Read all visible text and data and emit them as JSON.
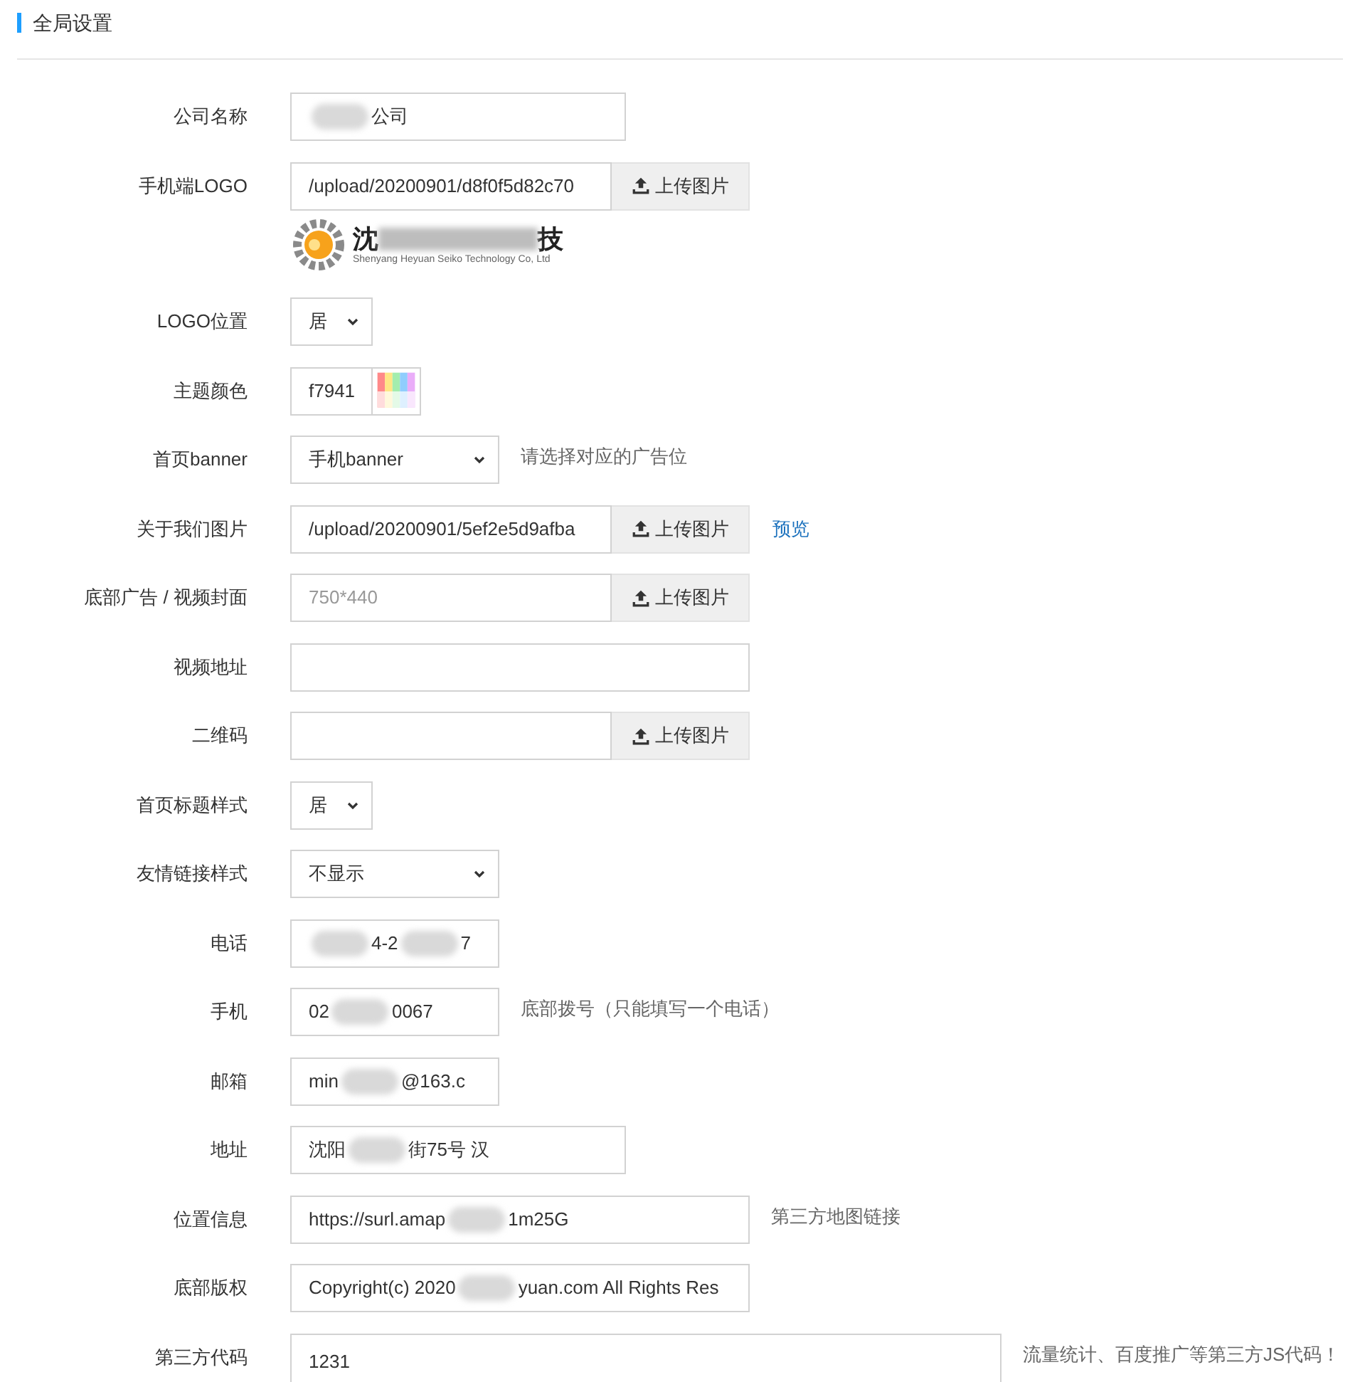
{
  "header": {
    "title": "全局设置"
  },
  "rows": [
    {
      "label": "公司名称",
      "kind": "text_medium",
      "parts": [
        {
          "kind": "blur"
        },
        {
          "kind": "text",
          "text": "公司"
        }
      ]
    },
    {
      "label": "手机端LOGO",
      "kind": "upload",
      "value": "/upload/20200901/d8f0f5d82c70",
      "button": "上传图片",
      "preview": {
        "first_char": "沈",
        "last_char": "技",
        "subtitle": "Shenyang Heyuan Seiko Technology Co, Ltd"
      }
    },
    {
      "label": "LOGO位置",
      "kind": "select_small",
      "value": "居"
    },
    {
      "label": "主题颜色",
      "kind": "color",
      "value": "f7941"
    },
    {
      "label": "首页banner",
      "kind": "select_medium",
      "value": "手机banner",
      "hint": "请选择对应的广告位"
    },
    {
      "label": "关于我们图片",
      "kind": "upload",
      "value": "/upload/20200901/5ef2e5d9afba",
      "button": "上传图片",
      "link": "预览"
    },
    {
      "label": "底部广告 / 视频封面",
      "kind": "upload",
      "placeholder": "750*440",
      "button": "上传图片"
    },
    {
      "label": "视频地址",
      "kind": "text_wide",
      "parts": []
    },
    {
      "label": "二维码",
      "kind": "upload",
      "button": "上传图片"
    },
    {
      "label": "首页标题样式",
      "kind": "select_small",
      "value": "居"
    },
    {
      "label": "友情链接样式",
      "kind": "select_medium",
      "value": "不显示"
    },
    {
      "label": "电话",
      "kind": "text_short",
      "parts": [
        {
          "kind": "blur"
        },
        {
          "kind": "text",
          "text": "4-2"
        },
        {
          "kind": "blur"
        },
        {
          "kind": "text",
          "text": "7"
        }
      ]
    },
    {
      "label": "手机",
      "kind": "text_short",
      "parts": [
        {
          "kind": "text",
          "text": "02"
        },
        {
          "kind": "blur"
        },
        {
          "kind": "text",
          "text": "0067"
        }
      ],
      "hint": "底部拨号（只能填写一个电话）"
    },
    {
      "label": "邮箱",
      "kind": "text_short",
      "parts": [
        {
          "kind": "text",
          "text": "min"
        },
        {
          "kind": "blur"
        },
        {
          "kind": "text",
          "text": "@163.c"
        }
      ]
    },
    {
      "label": "地址",
      "kind": "text_medium",
      "parts": [
        {
          "kind": "text",
          "text": "沈阳"
        },
        {
          "kind": "blur"
        },
        {
          "kind": "text",
          "text": "街75号 汉"
        }
      ]
    },
    {
      "label": "位置信息",
      "kind": "text_wide",
      "parts": [
        {
          "kind": "text",
          "text": "https://surl.amap"
        },
        {
          "kind": "blur"
        },
        {
          "kind": "text",
          "text": "1m25G"
        }
      ],
      "hint": "第三方地图链接"
    },
    {
      "label": "底部版权",
      "kind": "text_wide",
      "parts": [
        {
          "kind": "text",
          "text": "Copyright(c) 2020"
        },
        {
          "kind": "blur"
        },
        {
          "kind": "text",
          "text": "yuan.com All Rights Res"
        }
      ]
    },
    {
      "label": "第三方代码",
      "kind": "textarea",
      "value": "1231",
      "hint": "流量统计、百度推广等第三方JS代码！"
    }
  ]
}
